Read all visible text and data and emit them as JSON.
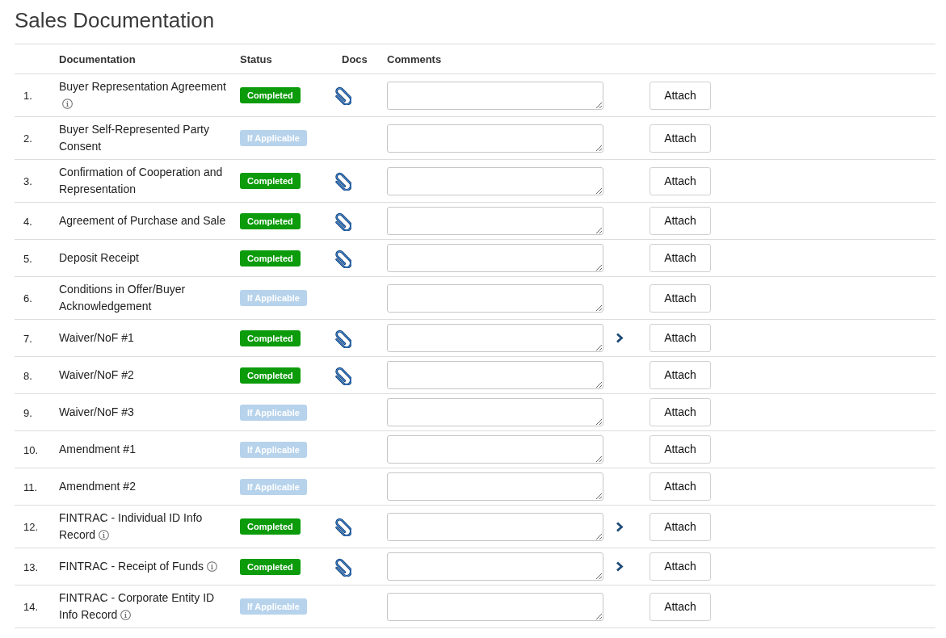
{
  "page": {
    "title": "Sales Documentation"
  },
  "table": {
    "columns": [
      "Documentation",
      "Status",
      "Docs",
      "Comments"
    ],
    "rows": [
      {
        "number": "1.",
        "document": "Buyer Representation Agreement",
        "has_info": true,
        "status": {
          "kind": "completed",
          "label": "Completed"
        },
        "has_attachment": true,
        "has_details": false,
        "button": "Attach"
      },
      {
        "number": "2.",
        "document": "Buyer Self-Represented Party Consent",
        "has_info": false,
        "status": {
          "kind": "optional",
          "label": "If Applicable"
        },
        "has_attachment": false,
        "has_details": false,
        "button": "Attach"
      },
      {
        "number": "3.",
        "document": "Confirmation of Cooperation and Representation",
        "has_info": false,
        "status": {
          "kind": "completed",
          "label": "Completed"
        },
        "has_attachment": true,
        "has_details": false,
        "button": "Attach"
      },
      {
        "number": "4.",
        "document": "Agreement of Purchase and Sale",
        "has_info": false,
        "status": {
          "kind": "completed",
          "label": "Completed"
        },
        "has_attachment": true,
        "has_details": false,
        "button": "Attach"
      },
      {
        "number": "5.",
        "document": "Deposit Receipt",
        "has_info": false,
        "status": {
          "kind": "completed",
          "label": "Completed"
        },
        "has_attachment": true,
        "has_details": false,
        "button": "Attach"
      },
      {
        "number": "6.",
        "document": "Conditions in Offer/Buyer Acknowledgement",
        "has_info": false,
        "status": {
          "kind": "optional",
          "label": "If Applicable"
        },
        "has_attachment": false,
        "has_details": false,
        "button": "Attach"
      },
      {
        "number": "7.",
        "document": "Waiver/NoF #1",
        "has_info": false,
        "status": {
          "kind": "completed",
          "label": "Completed"
        },
        "has_attachment": true,
        "has_details": true,
        "button": "Attach"
      },
      {
        "number": "8.",
        "document": "Waiver/NoF #2",
        "has_info": false,
        "status": {
          "kind": "completed",
          "label": "Completed"
        },
        "has_attachment": true,
        "has_details": false,
        "button": "Attach"
      },
      {
        "number": "9.",
        "document": "Waiver/NoF #3",
        "has_info": false,
        "status": {
          "kind": "optional",
          "label": "If Applicable"
        },
        "has_attachment": false,
        "has_details": false,
        "button": "Attach"
      },
      {
        "number": "10.",
        "document": "Amendment #1",
        "has_info": false,
        "status": {
          "kind": "optional",
          "label": "If Applicable"
        },
        "has_attachment": false,
        "has_details": false,
        "button": "Attach"
      },
      {
        "number": "11.",
        "document": "Amendment #2",
        "has_info": false,
        "status": {
          "kind": "optional",
          "label": "If Applicable"
        },
        "has_attachment": false,
        "has_details": false,
        "button": "Attach"
      },
      {
        "number": "12.",
        "document": "FINTRAC - Individual ID Info Record",
        "has_info": true,
        "status": {
          "kind": "completed",
          "label": "Completed"
        },
        "has_attachment": true,
        "has_details": true,
        "button": "Attach"
      },
      {
        "number": "13.",
        "document": "FINTRAC - Receipt of Funds",
        "has_info": true,
        "status": {
          "kind": "completed",
          "label": "Completed"
        },
        "has_attachment": true,
        "has_details": true,
        "button": "Attach"
      },
      {
        "number": "14.",
        "document": "FINTRAC - Corporate Entity ID Info Record",
        "has_info": true,
        "status": {
          "kind": "optional",
          "label": "If Applicable"
        },
        "has_attachment": false,
        "has_details": false,
        "button": "Attach"
      }
    ]
  }
}
